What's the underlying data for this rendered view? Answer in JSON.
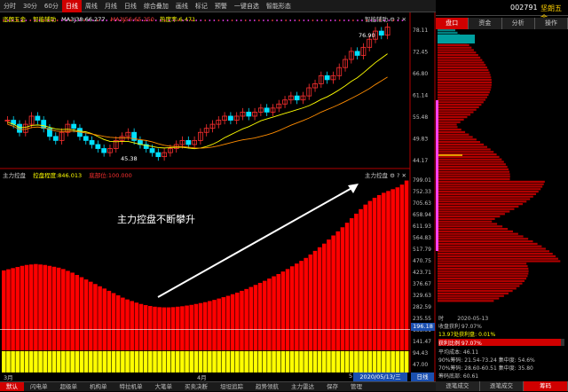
{
  "toolbar": {
    "items": [
      "分时",
      "30分",
      "60分",
      "日线",
      "周线",
      "月线",
      "日线",
      "综合叠加",
      "画线",
      "标记",
      "预警",
      "一键自选",
      "智能形态"
    ],
    "active_index": 3
  },
  "stock": {
    "code": "002791",
    "name": "坚朗五金"
  },
  "panel_tabs": [
    "盘口",
    "资金",
    "分析",
    "操作"
  ],
  "upper": {
    "name": "坚朗五金",
    "indicator": "智能辅助",
    "ma1": "MA3J38:66.277",
    "ma2": "MA3J56:65.250",
    "ma3": "热度率:6.471",
    "label_high": "76.90",
    "label_low": "45.38",
    "title_right": "智能辅助",
    "yticks": [
      "78.11",
      "72.45",
      "66.80",
      "61.14",
      "55.48",
      "49.83",
      "44.17"
    ]
  },
  "lower": {
    "name": "主力控盘",
    "indicator": "控盘程度:846.013",
    "indicator2": "底部位:100.000",
    "annotation": "主力控盘不断攀升",
    "title_right": "主力控盘",
    "yticks": [
      "799.01",
      "752.33",
      "705.63",
      "658.94",
      "611.93",
      "564.83",
      "517.79",
      "470.75",
      "423.71",
      "376.67",
      "329.63",
      "282.59",
      "235.55",
      "188.51",
      "141.47",
      "94.43",
      "47.00"
    ],
    "current_value": "196.18"
  },
  "xaxis": {
    "months": [
      "3月",
      "4月",
      "5"
    ],
    "date": "2020/05/13/三",
    "period": "日线"
  },
  "chip_stats": {
    "date_label": "时",
    "date": "2020-05-13",
    "profit_ratio": "收盘获利 97.07%",
    "price_profit": "13.97处获利盘: 0.01%",
    "profit_pct": "获利比例 97.07%",
    "avg_cost": "平均成本: 46.11",
    "c90": "90%筹码: 21.54-73.24",
    "c90_conc": "集中度: 54.6%",
    "c70": "70%筹码: 28.60-60.51",
    "c70_conc": "集中度: 35.80",
    "bottom": "筹码底部: 60.61"
  },
  "chip_buttons": [
    "逐笔成交",
    "逐笔成交",
    "筹码"
  ],
  "bottom_tabs": [
    "默认",
    "闪电单",
    "超级单",
    "机构单",
    "特拉机单",
    "大笔单",
    "买卖决断",
    "坦坦追踪",
    "趋势领航",
    "主力雷达",
    "保存",
    "管理"
  ],
  "bottom_active": 0,
  "chart_data": {
    "type": "bar",
    "title": "主力控盘",
    "series": [
      {
        "name": "控盘程度",
        "values": [
          450,
          455,
          460,
          465,
          470,
          474,
          476,
          478,
          476,
          474,
          470,
          466,
          462,
          456,
          448,
          440,
          430,
          420,
          410,
          400,
          390,
          380,
          370,
          360,
          350,
          340,
          330,
          322,
          315,
          308,
          302,
          297,
          293,
          290,
          288,
          287,
          287,
          288,
          290,
          292,
          295,
          298,
          302,
          306,
          310,
          315,
          320,
          326,
          332,
          338,
          345,
          352,
          360,
          368,
          377,
          386,
          395,
          404,
          414,
          424,
          434,
          445,
          456,
          468,
          480,
          492,
          505,
          520,
          536,
          552,
          568,
          586,
          604,
          622,
          640,
          660,
          680,
          700,
          720,
          740,
          756,
          770,
          782,
          792,
          800,
          808,
          816,
          828,
          846
        ]
      }
    ],
    "ylim": [
      47,
      846
    ],
    "annotation": "主力控盘不断攀升"
  }
}
